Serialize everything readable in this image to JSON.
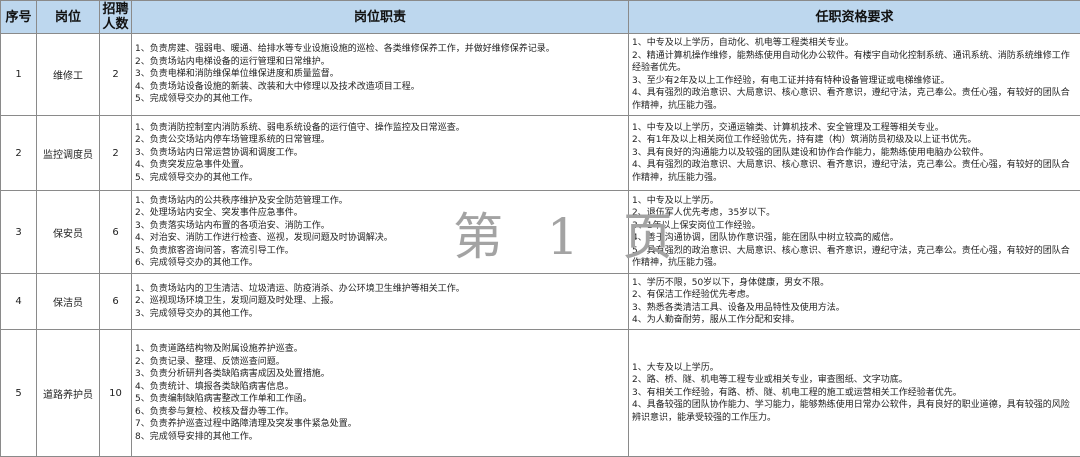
{
  "headers": {
    "seq": "序号",
    "position": "岗位",
    "recruit": "招聘人数",
    "duties": "岗位职责",
    "requirements": "任职资格要求"
  },
  "watermark": "第 1 页",
  "rows": [
    {
      "seq": "1",
      "position": "维修工",
      "count": "2",
      "duties": [
        "1、负责房建、强弱电、暖通、给排水等专业设施设施的巡检、各类维修保养工作，并做好维修保养记录。",
        "2、负责场站内电梯设备的运行管理和日常维护。",
        "3、负责电梯和消防维保单位维保进度和质量监督。",
        "4、负责场站设备设施的新装、改装和大中修理以及技术改造项目工程。",
        "5、完成领导交办的其他工作。"
      ],
      "requirements": [
        "1、中专及以上学历，自动化、机电等工程类相关专业。",
        "2、精通计算机操作维修，能熟练使用自动化办公软件。有楼宇自动化控制系统、通讯系统、消防系统维修工作经验者优先。",
        "3、至少有2年及以上工作经验，有电工证并持有特种设备管理证或电梯维修证。",
        "4、具有强烈的政治意识、大局意识、核心意识、看齐意识，遵纪守法，克己奉公。责任心强，有较好的团队合作精神，抗压能力强。"
      ]
    },
    {
      "seq": "2",
      "position": "监控调度员",
      "count": "2",
      "duties": [
        "1、负责消防控制室内消防系统、弱电系统设备的运行值守、操作监控及日常巡查。",
        "2、负责公交场站内停车场管理系统的日常管理。",
        "3、负责场站内日常运营协调和调度工作。",
        "4、负责突发应急事件处置。",
        "5、完成领导交办的其他工作。"
      ],
      "requirements": [
        "1、中专及以上学历，交通运输类、计算机技术、安全管理及工程等相关专业。",
        "2、有1年及以上相关岗位工作经验优先，持有建（构）筑消防员初级及以上证书优先。",
        "3、具有良好的沟通能力以及较强的团队建设和协作合作能力，能熟练使用电脑办公软件。",
        "4、具有强烈的政治意识、大局意识、核心意识、看齐意识，遵纪守法，克己奉公。责任心强，有较好的团队合作精神，抗压能力强。"
      ]
    },
    {
      "seq": "3",
      "position": "保安员",
      "count": "6",
      "duties": [
        "1、负责场站内的公共秩序维护及安全防范管理工作。",
        "2、处理场站内安全、突发事件应急事件。",
        "3、负责落实场站内布置的各项治安、消防工作。",
        "4、对治安、消防工作进行检查、巡视，发现问题及时协调解决。",
        "5、负责旅客咨询问答，客流引导工作。",
        "6、完成领导交办的其他工作。"
      ],
      "requirements": [
        "1、中专及以上学历。",
        "2、退伍军人优先考虑，35岁以下。",
        "3、1年以上保安岗位工作经验。",
        "4、善于沟通协调，团队协作意识强，能在团队中树立较高的威信。",
        "5、具有强烈的政治意识、大局意识、核心意识、看齐意识，遵纪守法，克己奉公。责任心强，有较好的团队合作精神，抗压能力强。"
      ]
    },
    {
      "seq": "4",
      "position": "保洁员",
      "count": "6",
      "duties": [
        "1、负责场站内的卫生清洁、垃圾清运、防疫消杀、办公环境卫生维护等相关工作。",
        "2、巡视现场环境卫生，发现问题及时处理、上报。",
        "3、完成领导交办的其他工作。"
      ],
      "requirements": [
        "1、学历不限，50岁以下，身体健康，男女不限。",
        "2、有保洁工作经验优先考虑。",
        "3、熟悉各类清洁工具、设备及用品特性及使用方法。",
        "4、为人勤奋耐劳，服从工作分配和安排。"
      ]
    },
    {
      "seq": "5",
      "position": "道路养护员",
      "count": "10",
      "duties": [
        "1、负责道路结构物及附属设施养护巡查。",
        "2、负责记录、整理、反馈巡查问题。",
        "3、负责分析研判各类缺陷病害成因及处置措施。",
        "4、负责统计、填报各类缺陷病害信息。",
        "5、负责编制缺陷病害整改工作单和工作函。",
        "6、负责参与复检、校核及督办等工作。",
        "7、负责养护巡查过程中路障清理及突发事件紧急处置。",
        "8、完成领导安排的其他工作。"
      ],
      "requirements": [
        "1、大专及以上学历。",
        "2、路、桥、隧、机电等工程专业或相关专业，审查图纸、文字功底。",
        "3、有相关工作经验，有路、桥、隧、机电工程的施工或运营相关工作经验者优先。",
        "4、具备较强的团队协作能力、学习能力，能够熟练使用日常办公软件，具有良好的职业道德，具有较强的风险辨识意识，能承受较强的工作压力。"
      ]
    }
  ]
}
